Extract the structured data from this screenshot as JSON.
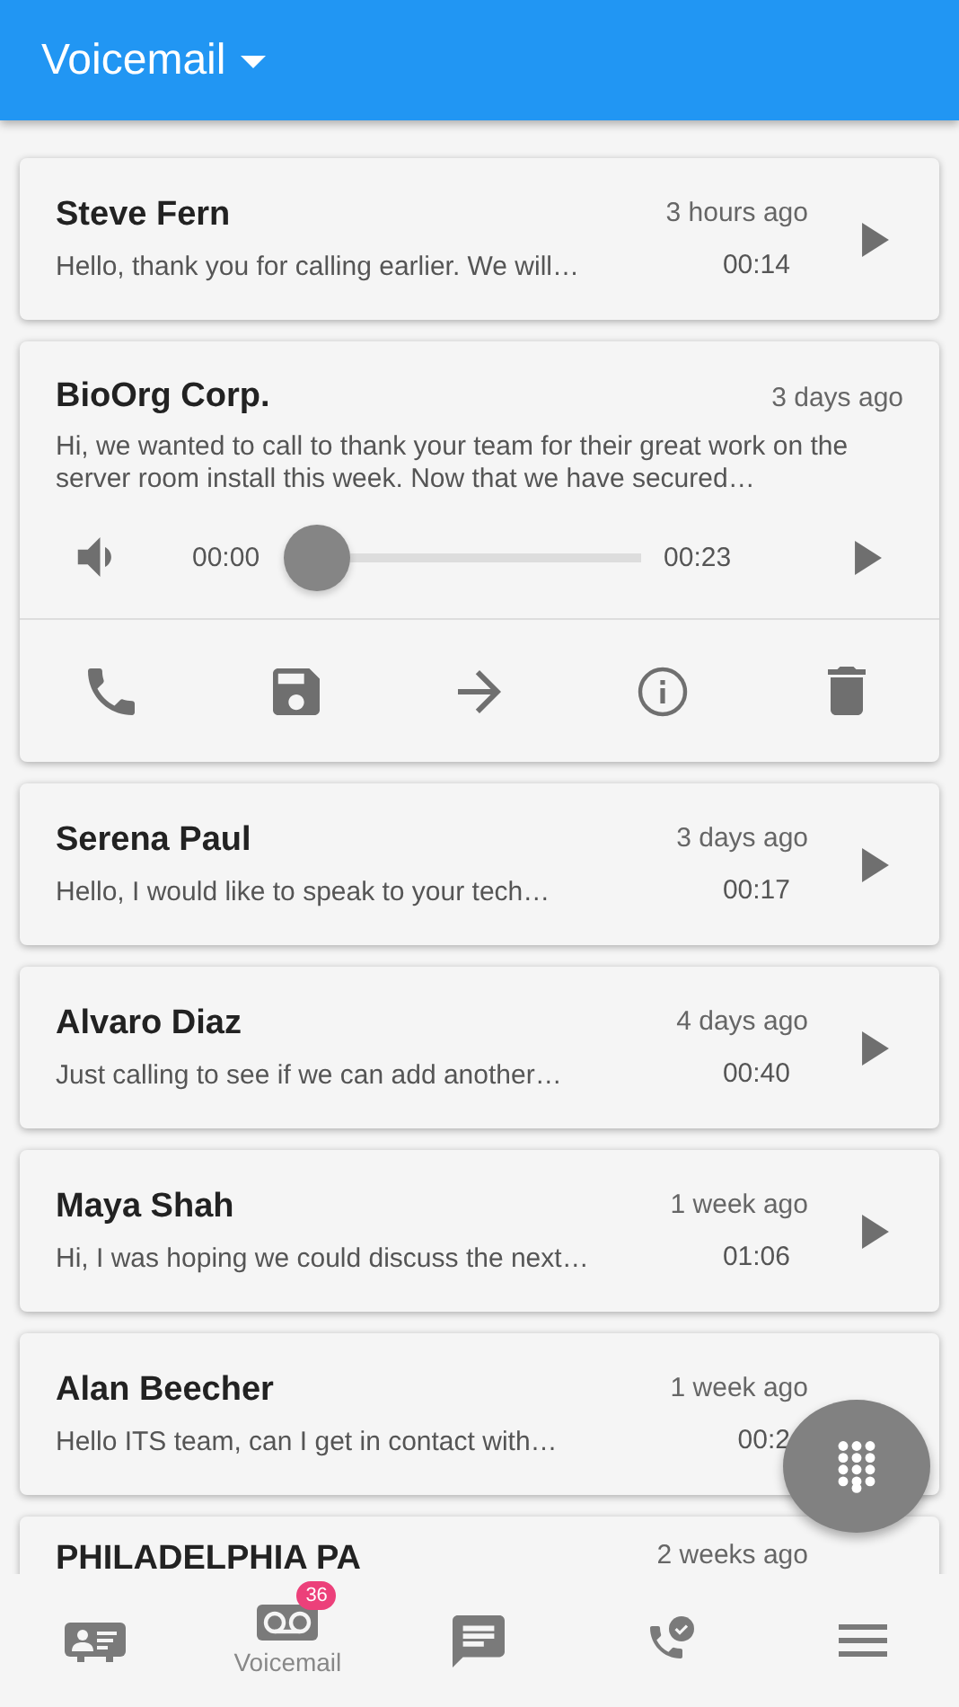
{
  "header": {
    "title": "Voicemail"
  },
  "voicemails": [
    {
      "name": "Steve Fern",
      "time": "3 hours ago",
      "preview": "Hello, thank you for calling earlier. We will…",
      "duration": "00:14",
      "expanded": false,
      "play_visible": true
    },
    {
      "name": "BioOrg Corp.",
      "time": "3 days ago",
      "preview": "Hi, we wanted to call to thank your team for their great work on the server room install this week. Now that we have secured…",
      "expanded": true,
      "player": {
        "elapsed": "00:00",
        "total": "00:23",
        "level": 0
      }
    },
    {
      "name": "Serena Paul",
      "time": "3 days ago",
      "preview": "Hello, I would like to speak to your tech…",
      "duration": "00:17",
      "expanded": false,
      "play_visible": true
    },
    {
      "name": "Alvaro Diaz",
      "time": "4 days ago",
      "preview": "Just calling to see if we can add another…",
      "duration": "00:40",
      "expanded": false,
      "play_visible": true
    },
    {
      "name": "Maya Shah",
      "time": "1 week ago",
      "preview": "Hi, I was hoping we could discuss the next…",
      "duration": "01:06",
      "expanded": false,
      "play_visible": true
    },
    {
      "name": "Alan Beecher",
      "time": "1 week ago",
      "preview": "Hello ITS team, can I get in contact with…",
      "duration": "00:2",
      "expanded": false,
      "play_visible": false
    },
    {
      "name": "PHILADELPHIA PA",
      "time": "2 weeks ago",
      "expanded": false,
      "play_visible": false
    }
  ],
  "bottom_nav": [
    {
      "selected": false
    },
    {
      "selected": true,
      "label": "Voicemail",
      "badge": "36"
    },
    {
      "selected": false
    },
    {
      "selected": false
    },
    {
      "selected": false
    }
  ]
}
